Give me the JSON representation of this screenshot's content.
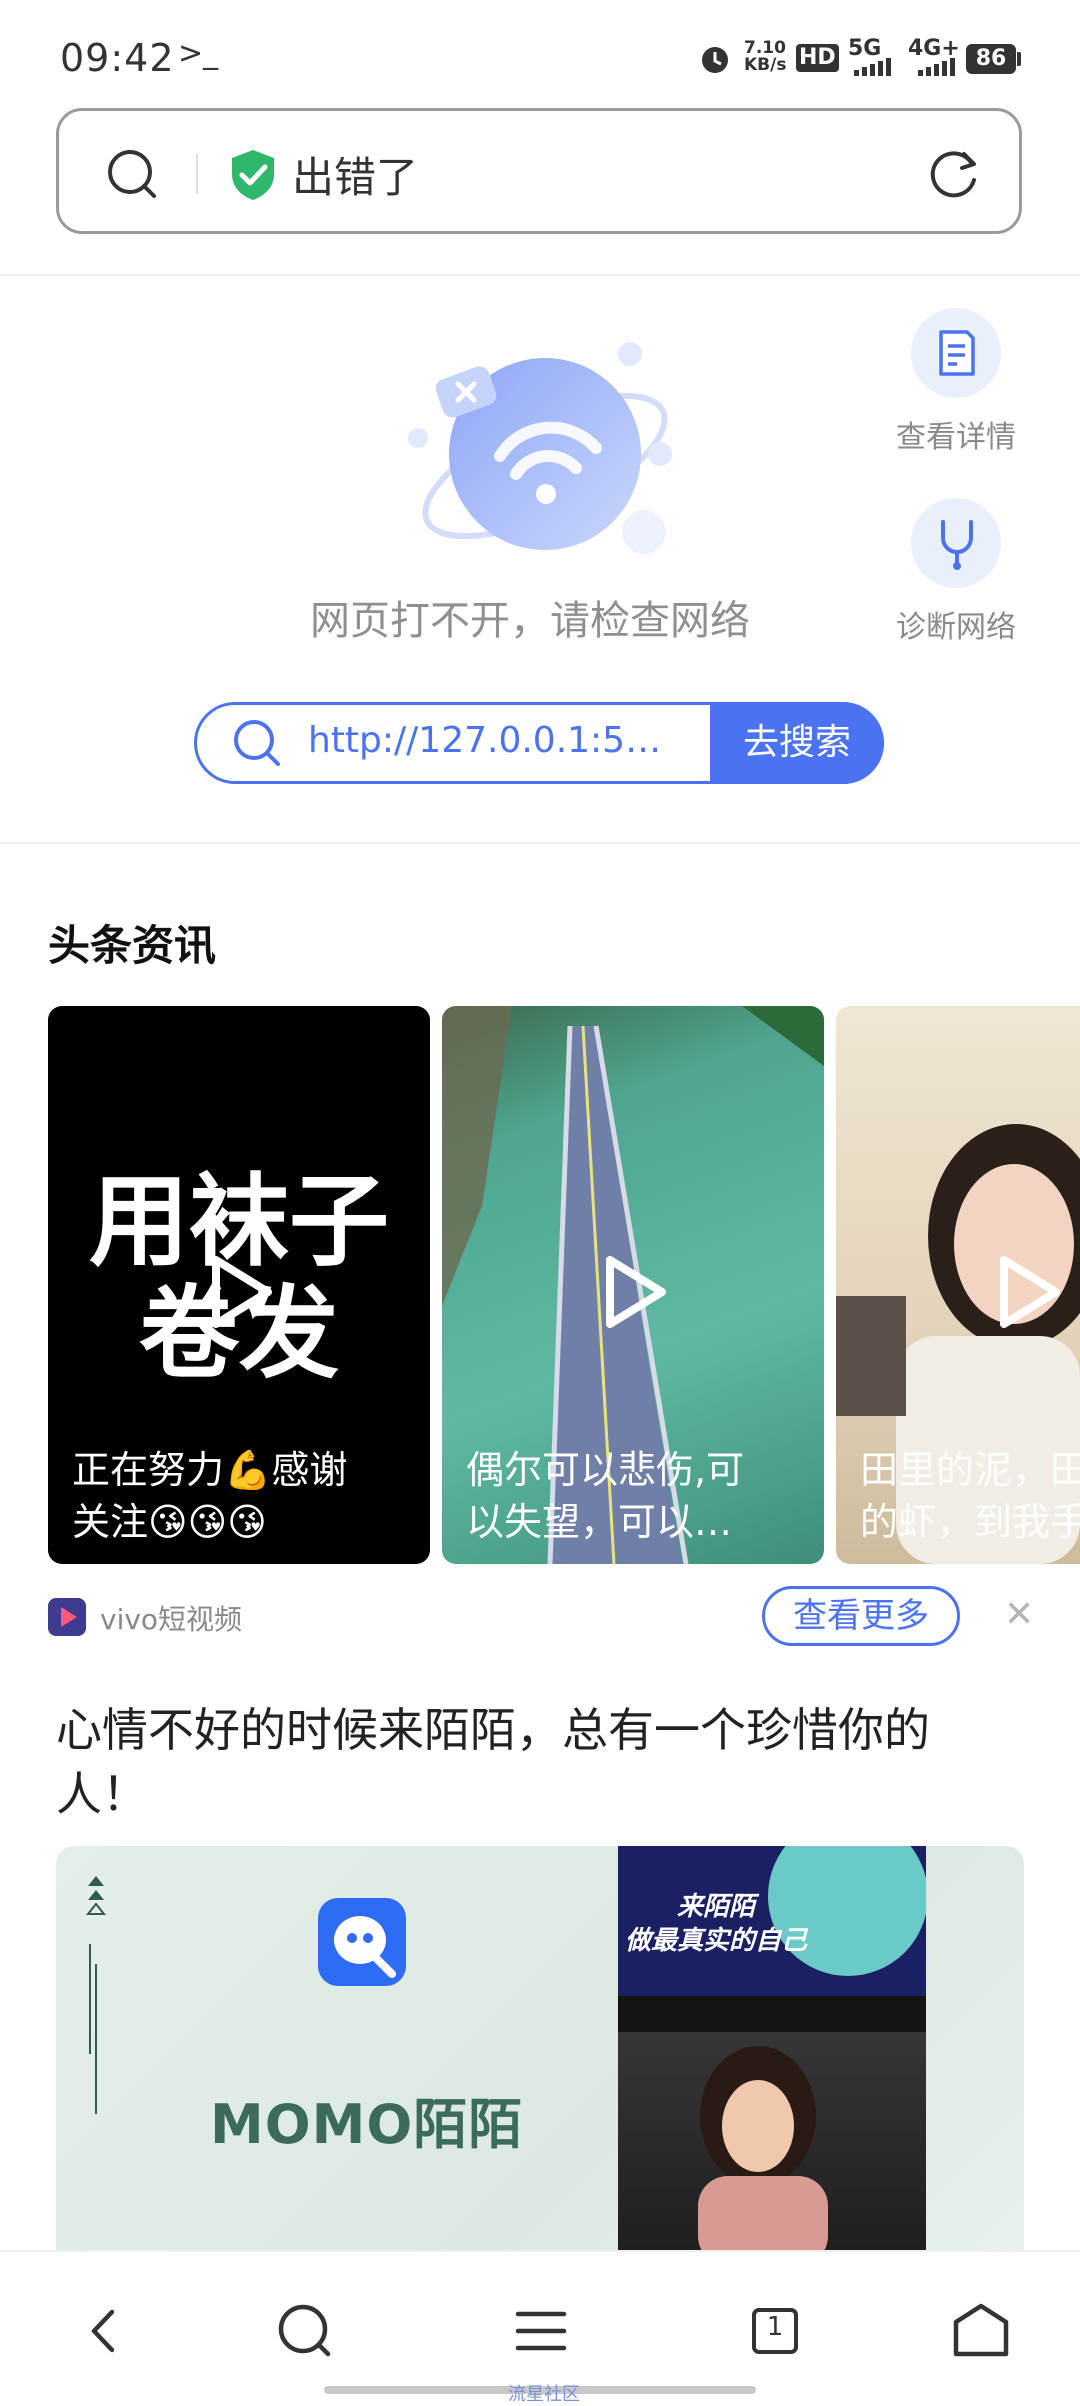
{
  "status_bar": {
    "time": "09:42",
    "terminal_glyph": ">_",
    "net_speed": "7.10",
    "net_speed_unit": "KB/s",
    "hd": "HD",
    "sim1": "5G",
    "sim2": "4G+",
    "battery": "86"
  },
  "address_bar": {
    "title": "出错了"
  },
  "error_page": {
    "message": "网页打不开，请检查网络",
    "details_label": "查看详情",
    "diagnose_label": "诊断网络",
    "search_value": "http://127.0.0.1:5…",
    "search_button": "去搜索"
  },
  "news": {
    "section_title": "头条资讯",
    "cards": [
      {
        "overlay": "用袜子\n卷发",
        "caption": "正在努力💪感谢\n关注😘😘😘"
      },
      {
        "caption": "偶尔可以悲伤,可\n以失望，可以…"
      },
      {
        "caption": "田里的泥，田\n的虾，到我手"
      }
    ],
    "source": "vivo短视频",
    "more_button": "查看更多",
    "close": "✕"
  },
  "ad": {
    "title": "心情不好的时候来陌陌，总有一个珍惜你的人！",
    "brand": "MOMO陌陌",
    "banner_line1": "来陌陌",
    "banner_line2": "做最真实的自己"
  },
  "bottom_nav": {
    "tab_count": "1",
    "home_label": "流星社区"
  },
  "colors": {
    "accent": "#4b72f0",
    "shield": "#2fb86b"
  }
}
